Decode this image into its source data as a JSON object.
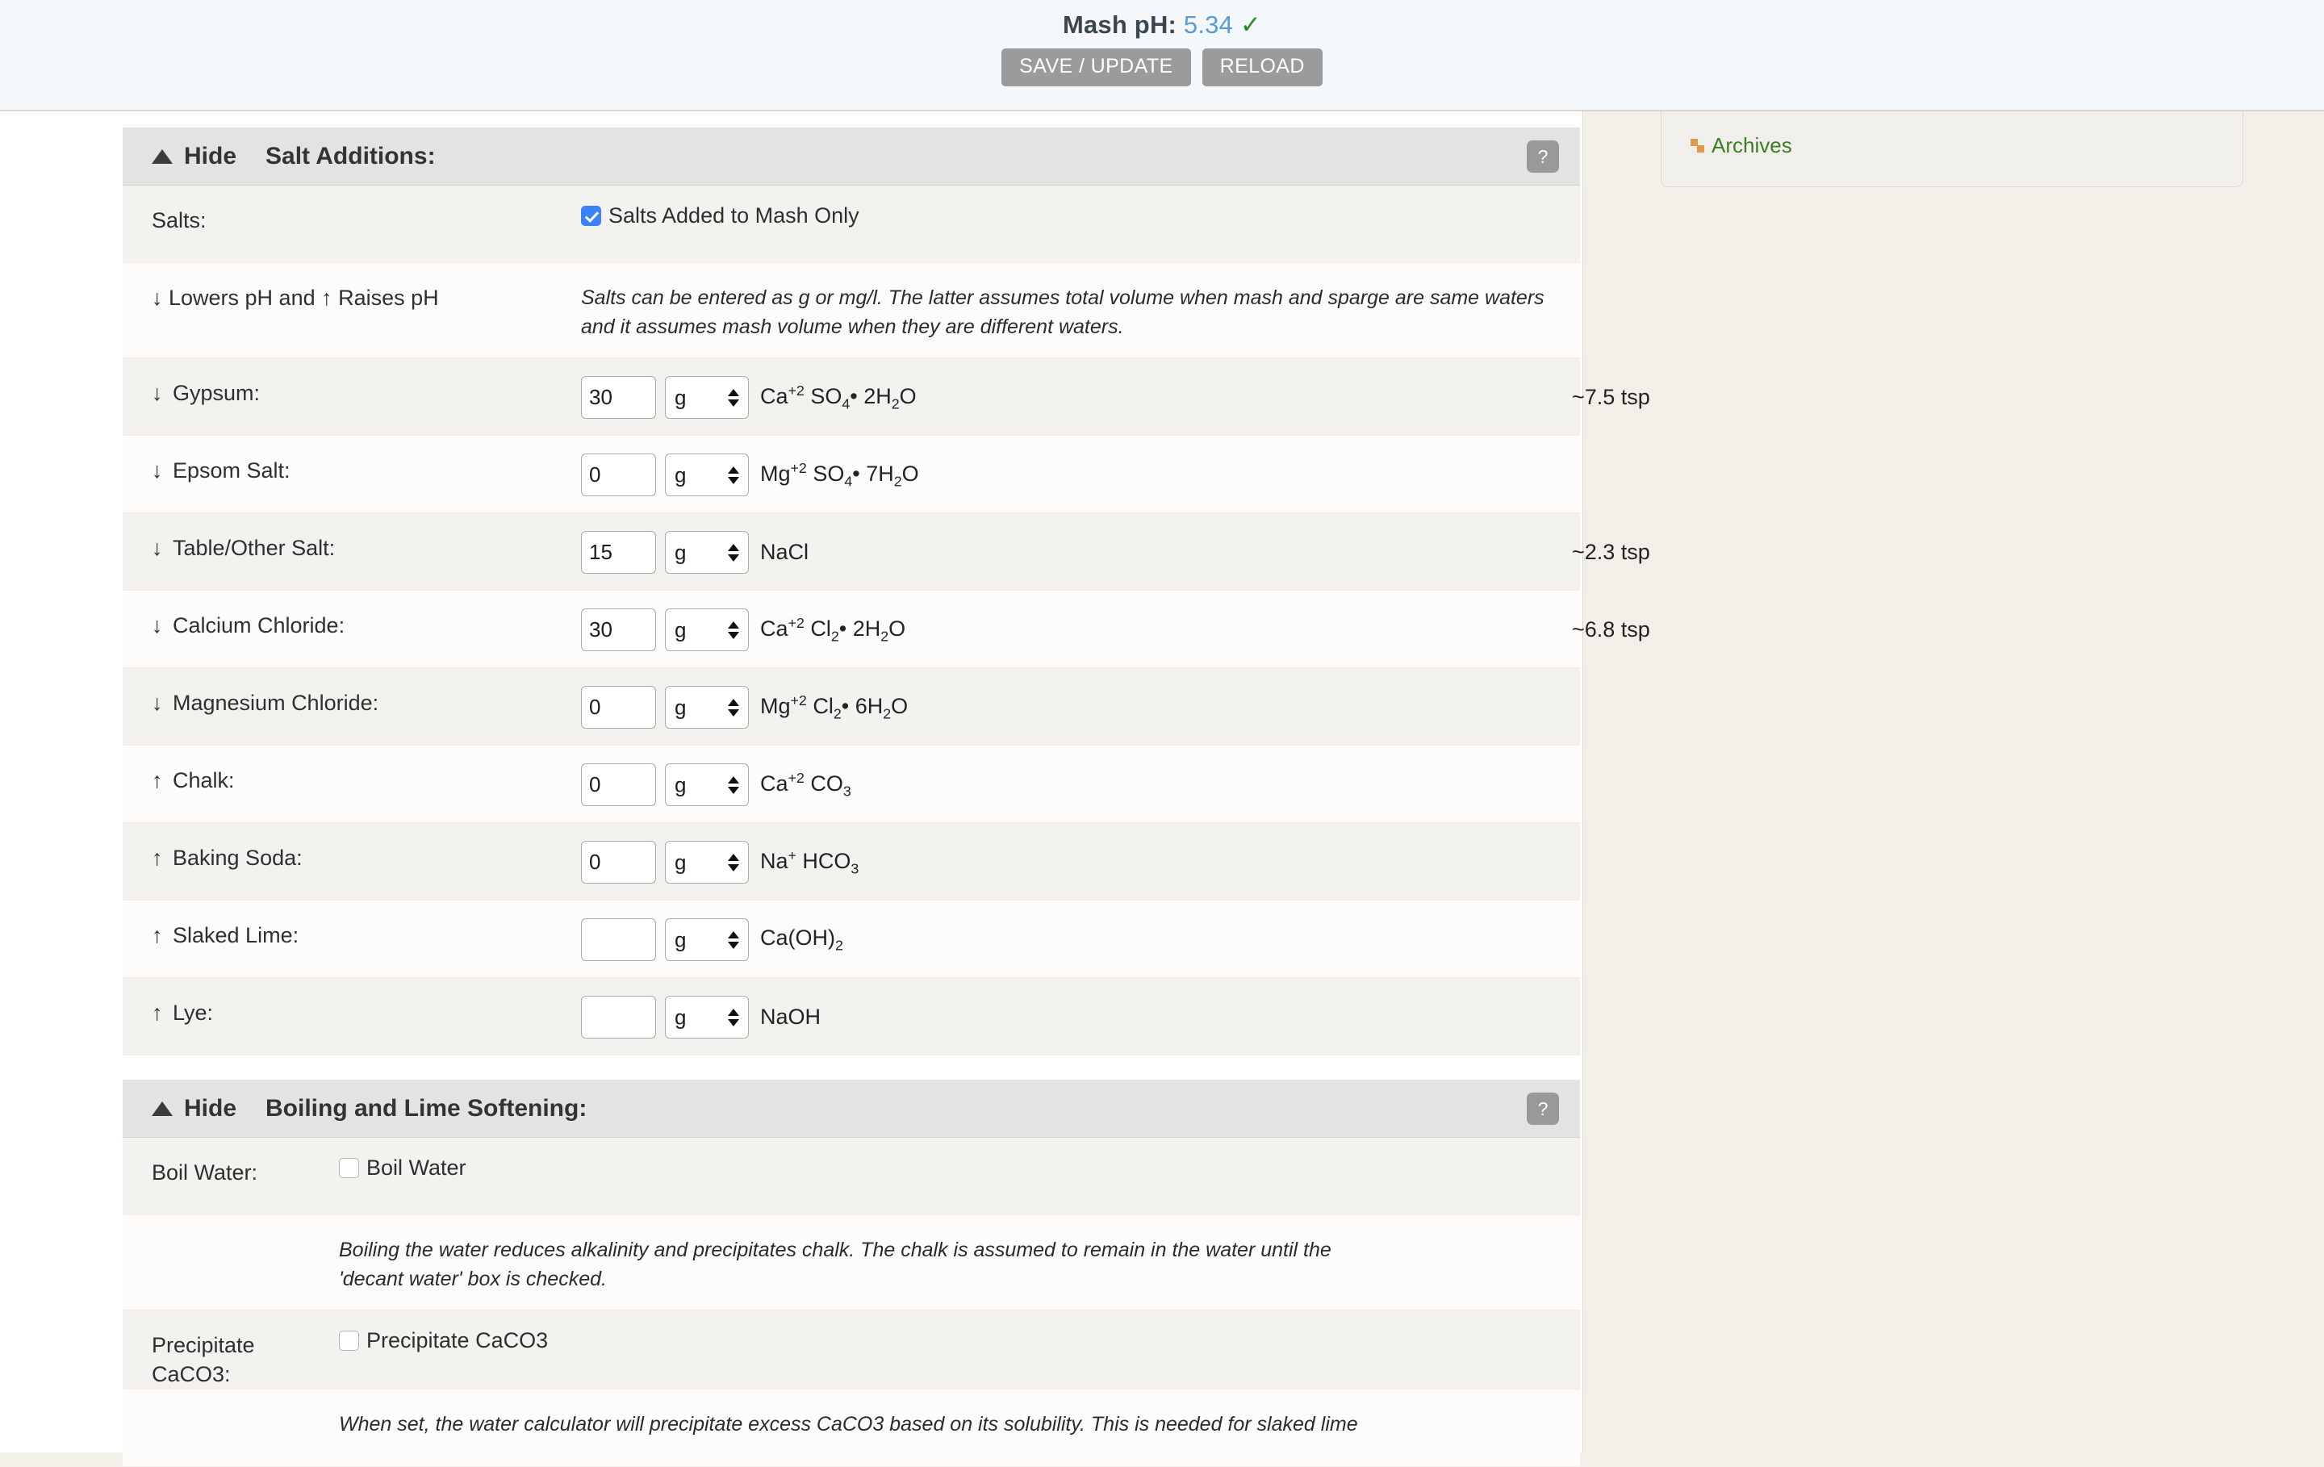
{
  "topbar": {
    "ph_label": "Mash pH:",
    "ph_value": "5.34",
    "ph_check": "✓",
    "save_label": "SAVE / UPDATE",
    "reload_label": "RELOAD",
    "ph_value_color": "#5b9bd5",
    "check_color": "#2e8b22"
  },
  "panels": {
    "salts": {
      "hide_label": "Hide",
      "title": "Salt Additions:",
      "help_label": "?",
      "salts_row": {
        "label": "Salts:",
        "checkbox_label": "Salts Added to Mash Only",
        "checked": true
      },
      "legend_row": {
        "label": "↓ Lowers pH and  ↑ Raises pH",
        "note": "Salts can be entered as g or mg/l. The latter assumes total volume when mash and sparge are same waters and it assumes mash volume when they are different waters."
      },
      "items": [
        {
          "arrow": "↓",
          "label": "Gypsum:",
          "value": "30",
          "unit": "g",
          "formula_html": "Ca<sup>+2</sup> SO<sub>4</sub>• 2H<sub>2</sub>O",
          "tsp": "~7.5 tsp"
        },
        {
          "arrow": "↓",
          "label": "Epsom Salt:",
          "value": "0",
          "unit": "g",
          "formula_html": "Mg<sup>+2</sup> SO<sub>4</sub>• 7H<sub>2</sub>O",
          "tsp": ""
        },
        {
          "arrow": "↓",
          "label": "Table/Other Salt:",
          "value": "15",
          "unit": "g",
          "formula_html": "NaCl",
          "tsp": "~2.3 tsp"
        },
        {
          "arrow": "↓",
          "label": "Calcium Chloride:",
          "value": "30",
          "unit": "g",
          "formula_html": "Ca<sup>+2</sup> Cl<sub>2</sub>• 2H<sub>2</sub>O",
          "tsp": "~6.8 tsp"
        },
        {
          "arrow": "↓",
          "label": "Magnesium Chloride:",
          "value": "0",
          "unit": "g",
          "formula_html": "Mg<sup>+2</sup> Cl<sub>2</sub>• 6H<sub>2</sub>O",
          "tsp": ""
        },
        {
          "arrow": "↑",
          "label": "Chalk:",
          "value": "0",
          "unit": "g",
          "formula_html": "Ca<sup>+2</sup> CO<sub>3</sub>",
          "tsp": ""
        },
        {
          "arrow": "↑",
          "label": "Baking Soda:",
          "value": "0",
          "unit": "g",
          "formula_html": "Na<sup>+</sup> HCO<sub>3</sub>",
          "tsp": ""
        },
        {
          "arrow": "↑",
          "label": "Slaked Lime:",
          "value": "",
          "unit": "g",
          "formula_html": "Ca(OH)<sub>2</sub>",
          "tsp": ""
        },
        {
          "arrow": "↑",
          "label": "Lye:",
          "value": "",
          "unit": "g",
          "formula_html": "NaOH",
          "tsp": ""
        }
      ]
    },
    "boiling": {
      "hide_label": "Hide",
      "title": "Boiling and Lime Softening:",
      "help_label": "?",
      "boil_row": {
        "label": "Boil Water:",
        "checkbox_label": "Boil Water",
        "checked": false
      },
      "boil_note": "Boiling the water reduces alkalinity and precipitates chalk. The chalk is assumed to remain in the water until the 'decant water' box is checked.",
      "precip_row": {
        "label": "Precipitate CaCO3:",
        "checkbox_label": "Precipitate CaCO3",
        "checked": false
      },
      "precip_note": "When set, the water calculator will precipitate excess CaCO3 based on its solubility. This is needed for slaked lime"
    }
  },
  "sidebar": {
    "archives_label": "Archives"
  }
}
